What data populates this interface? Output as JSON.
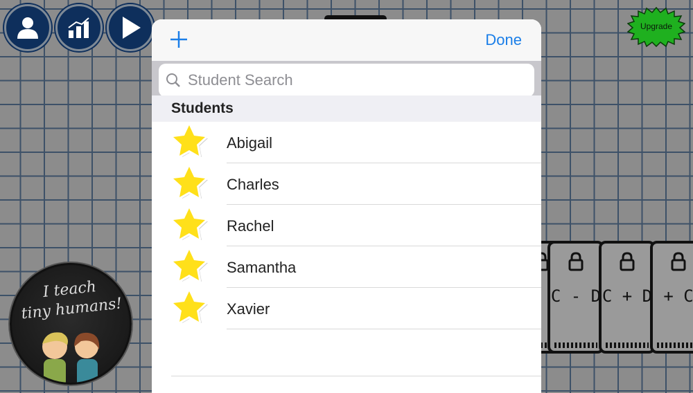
{
  "toolbar": {
    "profile_icon": "person-icon",
    "stats_icon": "bar-chart-icon",
    "play_icon": "play-icon",
    "upgrade_label": "Upgrade"
  },
  "badge": {
    "line1": "I teach",
    "line2": "tiny humans!"
  },
  "cards": [
    {
      "label": "C - D"
    },
    {
      "label": "C + D"
    },
    {
      "label": "+ C"
    }
  ],
  "modal": {
    "add_icon": "plus-icon",
    "add_symbol": "+",
    "done_label": "Done",
    "search": {
      "placeholder": "Student Search",
      "value": ""
    },
    "section_title": "Students",
    "students": [
      {
        "name": "Abigail",
        "icon": "star-icon"
      },
      {
        "name": "Charles",
        "icon": "star-icon"
      },
      {
        "name": "Rachel",
        "icon": "star-icon"
      },
      {
        "name": "Samantha",
        "icon": "star-icon"
      },
      {
        "name": "Xavier",
        "icon": "star-icon"
      }
    ]
  },
  "colors": {
    "accent": "#1a7ee8",
    "star": "#ffe01a",
    "nav_circle": "#0e2f5c",
    "upgrade": "#1fb01f"
  }
}
